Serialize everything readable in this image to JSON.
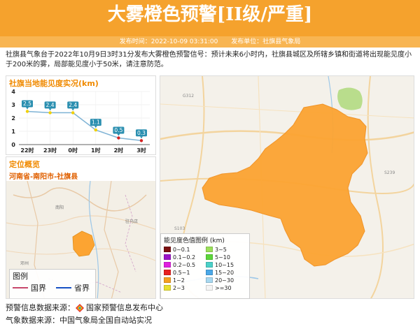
{
  "header": {
    "title": "大雾橙色预警[II级/严重]",
    "publish_time": "发布时间：2022-10-09 03:31:00",
    "publisher": "发布单位：社旗县气象局"
  },
  "description": "社旗县气象台于2022年10月9日3时31分发布大雾橙色预警信号：预计未来6小时内，社旗县城区及所辖乡镇和街道将出现能见度小于200米的雾，局部能见度小于50米，请注意防范。",
  "chart_panel": {
    "title": "社旗当地能见度实况(km)"
  },
  "chart_data": {
    "type": "line",
    "title": "社旗当地能见度实况(km)",
    "categories": [
      "22时",
      "23时",
      "0时",
      "1时",
      "2时",
      "3时"
    ],
    "values": [
      2.5,
      2.4,
      2.4,
      1.1,
      0.5,
      0.3
    ],
    "data_labels": [
      "2.5",
      "2.4",
      "2.4",
      "1.1",
      "0.5",
      "0.3"
    ],
    "y_ticks": [
      "0",
      "1",
      "2",
      "3",
      "4"
    ],
    "ylim": [
      0,
      4
    ],
    "grid": true,
    "colors": {
      "line": "#7fb3d5",
      "point_high": "#f0d000",
      "point_low": "#d42020",
      "label_bg": "#2b8fb0"
    }
  },
  "location_panel": {
    "title": "定位概览",
    "subtitle": "河南省-南阳市-社旗县",
    "legend": {
      "title": "图例",
      "items": [
        {
          "label": "国界",
          "color": "#c7476b"
        },
        {
          "label": "省界",
          "color": "#1650c4"
        }
      ]
    }
  },
  "map": {
    "warning_color": "#fca432",
    "legend": {
      "title": "能见度色值图例 (km)",
      "items": [
        {
          "label": "0~0.1",
          "color": "#7a1010"
        },
        {
          "label": "3~5",
          "color": "#9be05a"
        },
        {
          "label": "0.1~0.2",
          "color": "#9a14c8"
        },
        {
          "label": "5~10",
          "color": "#5cd63a"
        },
        {
          "label": "0.2~0.5",
          "color": "#e01ee0"
        },
        {
          "label": "10~15",
          "color": "#4ad0c8"
        },
        {
          "label": "0.5~1",
          "color": "#e82020"
        },
        {
          "label": "15~20",
          "color": "#4aa8e8"
        },
        {
          "label": "1~2",
          "color": "#f5a020"
        },
        {
          "label": "20~30",
          "color": "#a8d8f0"
        },
        {
          "label": "2~3",
          "color": "#e8e030"
        },
        {
          "label": ">=30",
          "color": "#f4f4f4"
        }
      ]
    }
  },
  "footer": {
    "warning_source_label": "预警信息数据来源：",
    "warning_source": "国家预警信息发布中心",
    "weather_source_label": "气象数据来源：",
    "weather_source": "中国气象局全国自动站实况"
  }
}
